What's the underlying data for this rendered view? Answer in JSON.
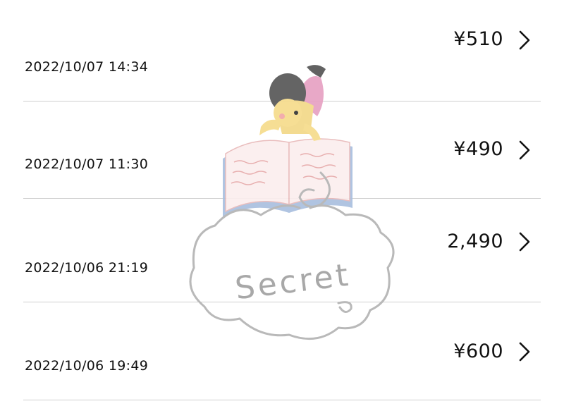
{
  "transactions": [
    {
      "amount": "¥510",
      "datetime": "2022/10/07 14:34"
    },
    {
      "amount": "¥490",
      "datetime": "2022/10/07 11:30"
    },
    {
      "amount": "2,490",
      "datetime": "2022/10/06 21:19"
    },
    {
      "amount": "¥600",
      "datetime": "2022/10/06 19:49"
    }
  ],
  "sticker": {
    "text": "Secret",
    "icon": "girl-reading-book-sticker"
  },
  "colors": {
    "divider": "#cfcfcf",
    "text": "#111111",
    "sticker_outline": "#b9b9b9"
  }
}
